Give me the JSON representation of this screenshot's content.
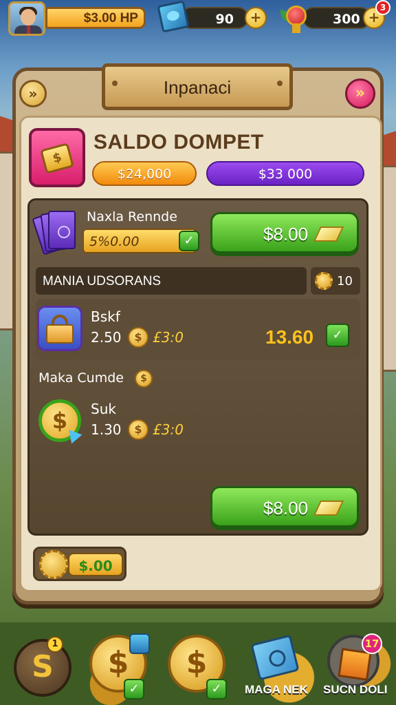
{
  "hud": {
    "money": "$3.00 HP",
    "gems": "90",
    "medals": "300",
    "notification_count": "3",
    "plus_symbol": "+"
  },
  "panel": {
    "title": "Inpanaci",
    "left_button_icon": "double-chevron-down-icon",
    "close_icon": "double-chevron-down-icon"
  },
  "wallet": {
    "title": "SALDO DOMPET",
    "balance_primary": "$24,000",
    "balance_secondary": "$33 000"
  },
  "offer": {
    "name": "Naxla Rennde",
    "bar_value": "5%0.00",
    "buy_label": "$8.00"
  },
  "section": {
    "header": "MANIA UDSORANS",
    "count": "10"
  },
  "items": [
    {
      "name": "Bskf",
      "value": "2.50",
      "price": "£3:0",
      "total": "13.60"
    },
    {
      "name": "Suk",
      "value": "1.30",
      "price": "£3:0"
    }
  ],
  "maka": {
    "label": "Maka Cumde"
  },
  "buy_bottom_label": "$8.00",
  "bottom_slot_value": "$.00",
  "nav": {
    "s_badge": "1",
    "gift_badge": "17",
    "label_market": "MAGA NEK",
    "label_shop": "SUCN DOLI"
  },
  "colors": {
    "accent_green": "#3aa21a",
    "accent_gold": "#e6a320",
    "accent_purple": "#6a22c4",
    "accent_pink": "#d81e6b"
  }
}
